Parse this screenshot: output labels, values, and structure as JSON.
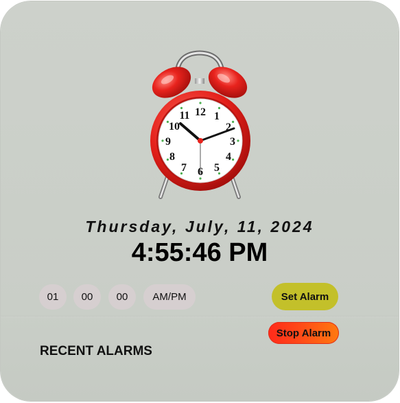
{
  "date": "Thursday, July, 11, 2024",
  "time": "4:55:46 PM",
  "alarm_inputs": {
    "hour": "01",
    "minute": "00",
    "second": "00",
    "ampm": "AM/PM"
  },
  "buttons": {
    "set_alarm": "Set Alarm",
    "stop_alarm": "Stop Alarm"
  },
  "recent_alarms_title": "RECENT ALARMS",
  "clock_icon": "alarm-clock-icon",
  "clock_numbers": [
    "12",
    "1",
    "2",
    "3",
    "4",
    "5",
    "6",
    "7",
    "8",
    "9",
    "10",
    "11"
  ],
  "colors": {
    "card_background": "#cbcfc9",
    "set_button": "#c3c02a",
    "stop_button": "#ff3a1a",
    "clock_body": "#e8231d",
    "pill": "#d6cfd0"
  }
}
